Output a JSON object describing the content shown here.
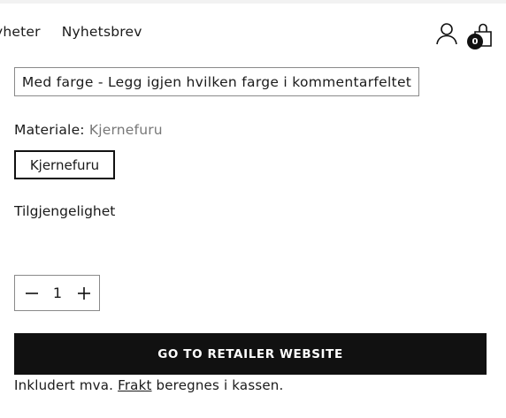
{
  "nav": {
    "items": [
      "yheter",
      "Nyhetsbrev"
    ]
  },
  "header": {
    "cart_count": "0"
  },
  "variant": {
    "selected": "Med farge - Legg igjen hvilken farge i kommentarfeltet"
  },
  "material": {
    "label": "Materiale:",
    "value": "Kjernefuru",
    "option": "Kjernefuru"
  },
  "availability": {
    "label": "Tilgjengelighet"
  },
  "quantity": {
    "value": "1"
  },
  "cta": {
    "label": "GO TO RETAILER WEBSITE"
  },
  "tax_note": {
    "prefix": "Inkludert mva.",
    "link": "Frakt",
    "suffix": "beregnes i kassen."
  }
}
